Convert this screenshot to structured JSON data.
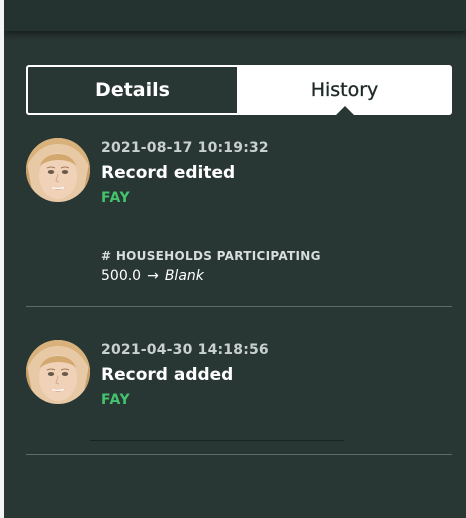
{
  "tabs": [
    {
      "label": "Details",
      "active": false
    },
    {
      "label": "History",
      "active": true
    }
  ],
  "history": [
    {
      "timestamp": "2021-08-17 10:19:32",
      "action": "Record edited",
      "user": "FAY",
      "change": {
        "field": "# HOUSEHOLDS PARTICIPATING",
        "old_value": "500.0",
        "arrow": "→",
        "new_value": "Blank"
      }
    },
    {
      "timestamp": "2021-04-30 14:18:56",
      "action": "Record added",
      "user": "FAY"
    }
  ],
  "colors": {
    "panel_bg": "#283634",
    "user_green": "#45c26d",
    "divider": "#5b6c69"
  }
}
